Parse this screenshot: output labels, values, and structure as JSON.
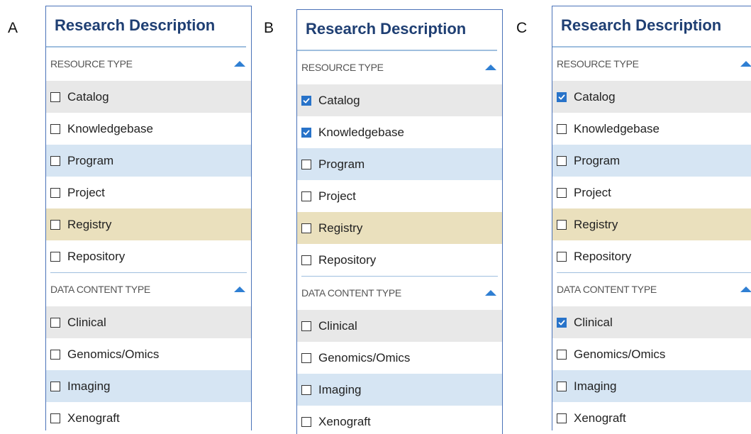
{
  "panels": [
    {
      "letter": "A",
      "title": "Research Description",
      "sections": [
        {
          "header": "RESOURCE TYPE",
          "options": [
            {
              "label": "Catalog",
              "checked": false,
              "bg": "gray"
            },
            {
              "label": "Knowledgebase",
              "checked": false,
              "bg": "white"
            },
            {
              "label": "Program",
              "checked": false,
              "bg": "blue"
            },
            {
              "label": "Project",
              "checked": false,
              "bg": "white"
            },
            {
              "label": "Registry",
              "checked": false,
              "bg": "tan"
            },
            {
              "label": "Repository",
              "checked": false,
              "bg": "white"
            }
          ]
        },
        {
          "header": "DATA CONTENT TYPE",
          "options": [
            {
              "label": "Clinical",
              "checked": false,
              "bg": "gray"
            },
            {
              "label": "Genomics/Omics",
              "checked": false,
              "bg": "white"
            },
            {
              "label": "Imaging",
              "checked": false,
              "bg": "blue"
            },
            {
              "label": "Xenograft",
              "checked": false,
              "bg": "white"
            }
          ]
        }
      ]
    },
    {
      "letter": "B",
      "title": "Research Description",
      "sections": [
        {
          "header": "RESOURCE TYPE",
          "options": [
            {
              "label": "Catalog",
              "checked": true,
              "bg": "gray"
            },
            {
              "label": "Knowledgebase",
              "checked": true,
              "bg": "white"
            },
            {
              "label": "Program",
              "checked": false,
              "bg": "blue"
            },
            {
              "label": "Project",
              "checked": false,
              "bg": "white"
            },
            {
              "label": "Registry",
              "checked": false,
              "bg": "tan"
            },
            {
              "label": "Repository",
              "checked": false,
              "bg": "white"
            }
          ]
        },
        {
          "header": "DATA CONTENT TYPE",
          "options": [
            {
              "label": "Clinical",
              "checked": false,
              "bg": "gray"
            },
            {
              "label": "Genomics/Omics",
              "checked": false,
              "bg": "white"
            },
            {
              "label": "Imaging",
              "checked": false,
              "bg": "blue"
            },
            {
              "label": "Xenograft",
              "checked": false,
              "bg": "white"
            }
          ]
        }
      ]
    },
    {
      "letter": "C",
      "title": "Research Description",
      "sections": [
        {
          "header": "RESOURCE TYPE",
          "options": [
            {
              "label": "Catalog",
              "checked": true,
              "bg": "gray"
            },
            {
              "label": "Knowledgebase",
              "checked": false,
              "bg": "white"
            },
            {
              "label": "Program",
              "checked": false,
              "bg": "blue"
            },
            {
              "label": "Project",
              "checked": false,
              "bg": "white"
            },
            {
              "label": "Registry",
              "checked": false,
              "bg": "tan"
            },
            {
              "label": "Repository",
              "checked": false,
              "bg": "white"
            }
          ]
        },
        {
          "header": "DATA CONTENT TYPE",
          "options": [
            {
              "label": "Clinical",
              "checked": true,
              "bg": "gray"
            },
            {
              "label": "Genomics/Omics",
              "checked": false,
              "bg": "white"
            },
            {
              "label": "Imaging",
              "checked": false,
              "bg": "blue"
            },
            {
              "label": "Xenograft",
              "checked": false,
              "bg": "white"
            }
          ]
        }
      ]
    }
  ],
  "colors": {
    "title": "#1f3f73",
    "accent": "#2873c9",
    "border": "#4a72b8",
    "row_gray": "#e8e8e8",
    "row_blue": "#d6e5f3",
    "row_tan": "#eae0bd"
  }
}
